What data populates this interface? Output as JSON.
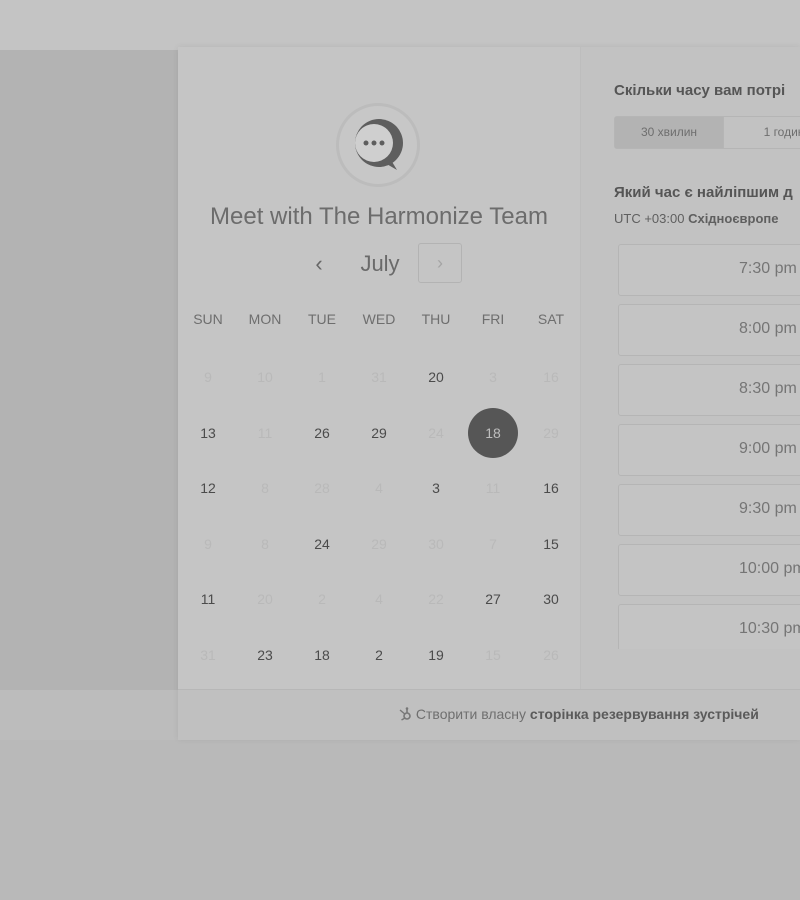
{
  "calendar": {
    "team_title": "Meet with The Harmonize Team",
    "month": "July",
    "prev_symbol": "‹",
    "next_symbol": "›",
    "days_of_week": [
      "SUN",
      "MON",
      "TUE",
      "WED",
      "THU",
      "FRI",
      "SAT"
    ],
    "weeks": [
      [
        {
          "t": "9",
          "s": "inactive"
        },
        {
          "t": "10",
          "s": "inactive"
        },
        {
          "t": "1",
          "s": "inactive"
        },
        {
          "t": "31",
          "s": "inactive"
        },
        {
          "t": "20",
          "s": "active"
        },
        {
          "t": "3",
          "s": "inactive"
        },
        {
          "t": "16",
          "s": "inactive"
        }
      ],
      [
        {
          "t": "13",
          "s": "active"
        },
        {
          "t": "11",
          "s": "inactive"
        },
        {
          "t": "26",
          "s": "active"
        },
        {
          "t": "29",
          "s": "active"
        },
        {
          "t": "24",
          "s": "inactive"
        },
        {
          "t": "18",
          "s": "selected"
        },
        {
          "t": "29",
          "s": "inactive"
        }
      ],
      [
        {
          "t": "12",
          "s": "active"
        },
        {
          "t": "8",
          "s": "inactive"
        },
        {
          "t": "28",
          "s": "inactive"
        },
        {
          "t": "4",
          "s": "inactive"
        },
        {
          "t": "3",
          "s": "active"
        },
        {
          "t": "11",
          "s": "inactive"
        },
        {
          "t": "16",
          "s": "active"
        }
      ],
      [
        {
          "t": "9",
          "s": "inactive"
        },
        {
          "t": "8",
          "s": "inactive"
        },
        {
          "t": "24",
          "s": "active"
        },
        {
          "t": "29",
          "s": "inactive"
        },
        {
          "t": "30",
          "s": "inactive"
        },
        {
          "t": "7",
          "s": "inactive"
        },
        {
          "t": "15",
          "s": "active"
        }
      ],
      [
        {
          "t": "11",
          "s": "active"
        },
        {
          "t": "20",
          "s": "inactive"
        },
        {
          "t": "2",
          "s": "inactive"
        },
        {
          "t": "4",
          "s": "inactive"
        },
        {
          "t": "22",
          "s": "inactive"
        },
        {
          "t": "27",
          "s": "active"
        },
        {
          "t": "30",
          "s": "active"
        }
      ],
      [
        {
          "t": "31",
          "s": "inactive"
        },
        {
          "t": "23",
          "s": "active"
        },
        {
          "t": "18",
          "s": "active"
        },
        {
          "t": "2",
          "s": "active"
        },
        {
          "t": "19",
          "s": "active"
        },
        {
          "t": "15",
          "s": "inactive"
        },
        {
          "t": "26",
          "s": "inactive"
        }
      ]
    ]
  },
  "scheduler": {
    "duration_question": "Скільки часу вам потрі",
    "durations": [
      "30 хвилин",
      "1 годин"
    ],
    "selected_duration": "30 хвилин",
    "time_question": "Який час є найліпшим д",
    "timezone_offset": "UTC +03:00",
    "timezone_name": "Східноєвропе",
    "slots": [
      "7:30 pm",
      "8:00 pm",
      "8:30 pm",
      "9:00 pm",
      "9:30 pm",
      "10:00 pm",
      "10:30 pm"
    ]
  },
  "footer": {
    "prefix": "Створити власну",
    "link": "сторінка резервування зустрічей"
  },
  "icons": {
    "avatar": "chat-bubble-logo-icon",
    "footer": "hubspot-sprocket-icon"
  },
  "colors": {
    "selected_day": "#565656",
    "active_text": "#4b4b4b",
    "inactive_text": "#b9b9b9"
  }
}
